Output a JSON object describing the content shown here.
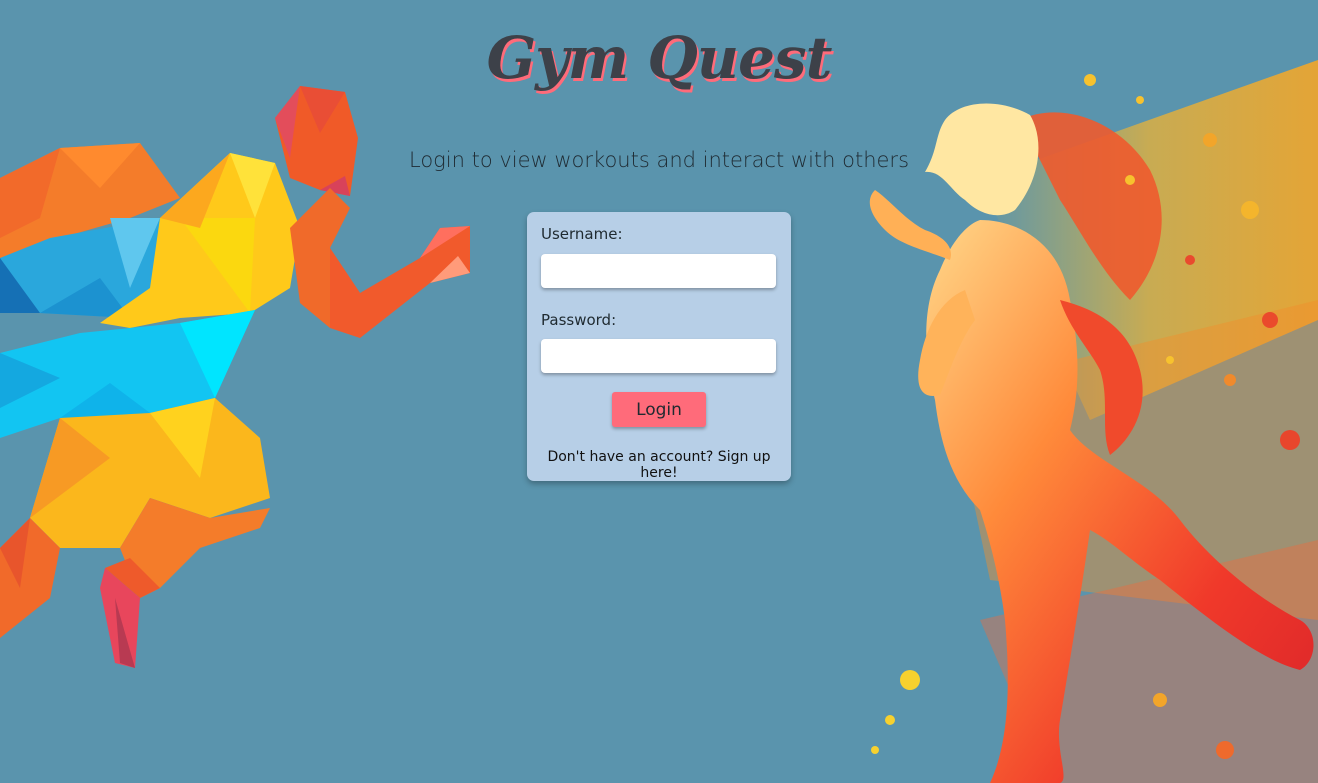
{
  "app": {
    "title": "Gym Quest",
    "subtitle": "Login to view workouts and interact with others"
  },
  "login_form": {
    "username_label": "Username:",
    "username_value": "",
    "password_label": "Password:",
    "password_value": "",
    "login_button": "Login",
    "signup_link": "Don't have an account? Sign up here!"
  },
  "colors": {
    "background": "#5a94ad",
    "card": "#b7cfe7",
    "accent": "#ff6b7a",
    "title": "#3d4149"
  },
  "images": {
    "left": "low-poly-runner-illustration",
    "right": "watercolor-woman-runner-illustration"
  }
}
